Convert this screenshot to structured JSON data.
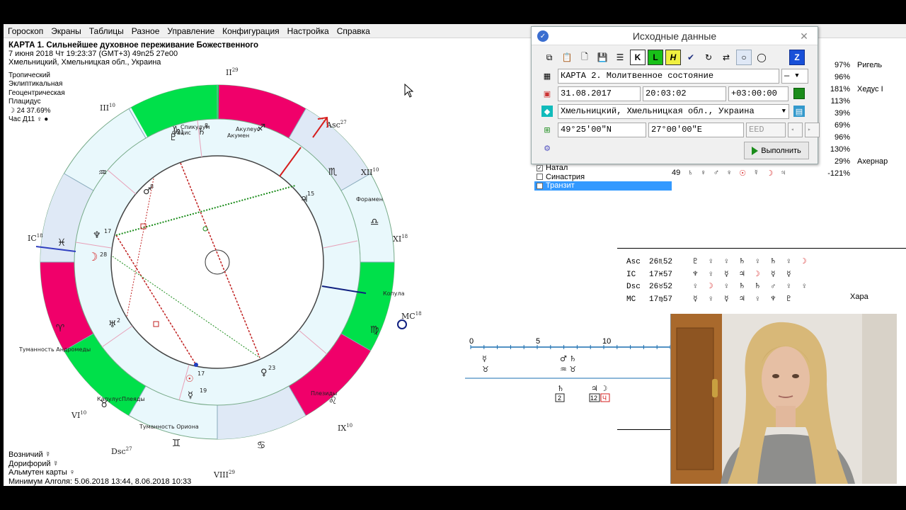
{
  "menu": [
    "Гороскоп",
    "Экраны",
    "Таблицы",
    "Разное",
    "Управление",
    "Конфигурация",
    "Настройка",
    "Справка"
  ],
  "chart_info": {
    "title": "КАРТА 1. Сильнейшее духовное переживание Божественного",
    "datetime": "7 июня 2018  Чт  19:23:37 (GMT+3) 49n25  27e00",
    "place": "Хмельницкий, Хмельницкая обл., Украина"
  },
  "props": {
    "zodiac": "Тропический",
    "coord": "Эклиптикальная",
    "center": "Геоцентрическая",
    "houses": "Плацидус",
    "moon_phase": "☽  24 37.69%",
    "hour": "Час Д11  ♀  ●"
  },
  "bottom": {
    "ruler": "Возничий  ☿",
    "doryphory": "Дорифорий  ☿",
    "almuten": "Альмутен карты  ♀",
    "algol": "Минимум Алголя: 5.06.2018 13:44,  8.06.2018 10:33"
  },
  "houses_labels": {
    "II": "II",
    "II_deg": "29",
    "III": "III",
    "III_deg": "10",
    "IC": "IC",
    "IC_deg": "18",
    "VI": "VI",
    "VI_deg": "10",
    "Dsc": "Dsc",
    "Dsc_deg": "27",
    "VIII": "VIII",
    "VIII_deg": "29",
    "IX": "IX",
    "IX_deg": "10",
    "MC": "MC",
    "MC_deg": "18",
    "XI": "XI",
    "XI_deg": "18",
    "XII": "XII",
    "XII_deg": "10",
    "Asc": "Asc",
    "Asc_deg": "27"
  },
  "fixed_stars": {
    "Спикулум": "Спикулум",
    "Фацис": "Фацис",
    "Акулеус": "Акулеус",
    "Акумен": "Акумен",
    "Форамен": "Форамен",
    "Копула": "Копула",
    "Плезиды": "Плезиды",
    "Туманность Ориона": "Туманность Ориона",
    "Капулус": "Капулус",
    "Плеяды": "Плеяды",
    "Туманность Андромеды": "Туманность Андромеды"
  },
  "stars": [
    {
      "pct": "97%",
      "name": "Ригель"
    },
    {
      "pct": "96%",
      "name": ""
    },
    {
      "pct": "181%",
      "name": "Хедус I"
    },
    {
      "pct": "113%",
      "name": ""
    },
    {
      "pct": "39%",
      "name": ""
    },
    {
      "pct": "69%",
      "name": ""
    },
    {
      "pct": "96%",
      "name": ""
    },
    {
      "pct": "130%",
      "name": ""
    },
    {
      "pct": "29%",
      "name": "Ахернар"
    },
    {
      "pct": "-121%",
      "name": ""
    }
  ],
  "dialog": {
    "title": "Исходные данные",
    "chart_name": "КАРТА 2. Молитвенное состояние",
    "chart_name_select": "—",
    "date": "31.08.2017",
    "time": "20:03:02",
    "tz": "+03:00:00",
    "place": "Хмельницкий, Хмельницкая обл., Украина",
    "lat": "49°25'00\"N",
    "lon": "27°00'00\"E",
    "code": "EED",
    "run": "Выполнить",
    "toolbar_k": "K",
    "toolbar_l": "L",
    "toolbar_h": "H",
    "toolbar_z": "Z"
  },
  "checklist": [
    {
      "label": "Натал",
      "checked": true
    },
    {
      "label": "Синастрия",
      "checked": false
    },
    {
      "label": "Транзит",
      "checked": false
    }
  ],
  "aspect_row": {
    "num": "49",
    "symbols": [
      "♄",
      "♀",
      "♂",
      "♀",
      "☉",
      "☿",
      "☽",
      "♃"
    ]
  },
  "angles": [
    {
      "name": "Asc",
      "pos": "26♏52",
      "symbols": [
        "♇",
        "♀",
        "♀",
        "♄",
        "♀",
        "♄",
        "♀",
        "☽"
      ]
    },
    {
      "name": "IC",
      "pos": "17♓57",
      "symbols": [
        "♆",
        "♀",
        "☿",
        "♃",
        "☽",
        "☿",
        "☿"
      ]
    },
    {
      "name": "Dsc",
      "pos": "26♉52",
      "symbols": [
        "♀",
        "☽",
        "♀",
        "♄",
        "♄",
        "♂",
        "♀",
        "♀"
      ]
    },
    {
      "name": "MC",
      "pos": "17♍57",
      "symbols": [
        "☿",
        "♀",
        "☿",
        "♃",
        "♀",
        "♆",
        "♇"
      ]
    }
  ],
  "hara": "Хара",
  "timeline": {
    "ticks": [
      "0",
      "5",
      "10"
    ],
    "upper": [
      "☿",
      "♂ ♄",
      "♉",
      "♒ ♉"
    ],
    "lower": [
      "♄",
      "♃ ☽"
    ],
    "boxes": [
      "2",
      "12",
      "Ч"
    ]
  },
  "colors": {
    "green": "#00e04a",
    "magenta": "#f0006a",
    "light_blue": "#dfe9f6",
    "ring": "#e9f8fc",
    "red": "#d61e1e"
  }
}
